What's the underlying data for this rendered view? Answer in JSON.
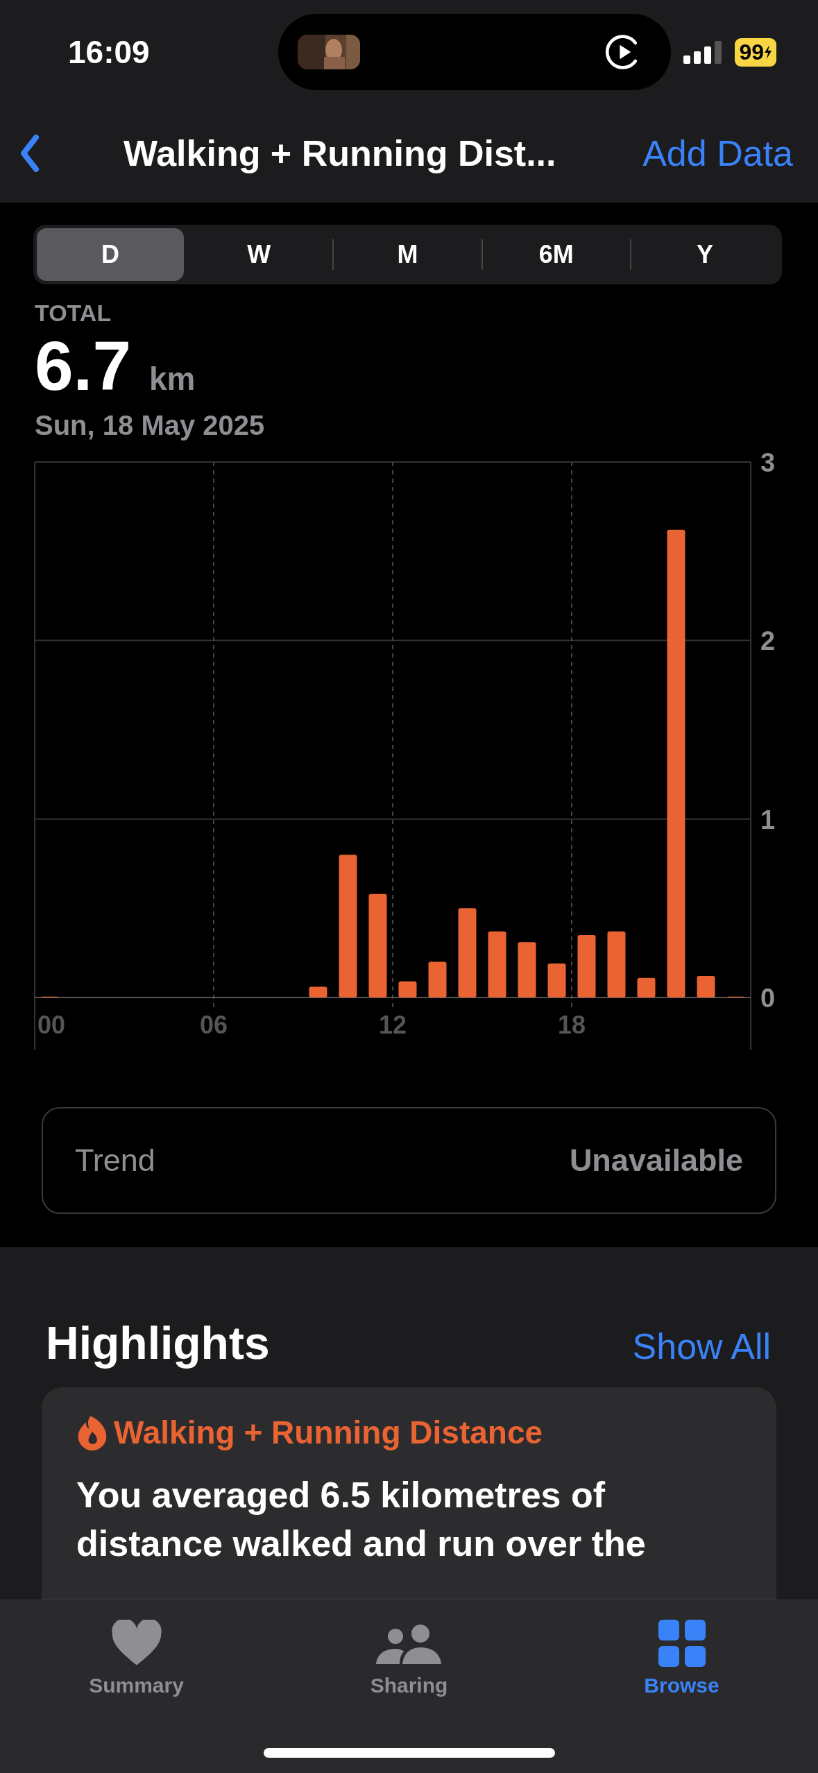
{
  "status_bar": {
    "time": "16:09",
    "battery": "99"
  },
  "nav": {
    "title": "Walking + Running Dist...",
    "action": "Add Data"
  },
  "segments": [
    {
      "label": "D",
      "selected": true
    },
    {
      "label": "W",
      "selected": false
    },
    {
      "label": "M",
      "selected": false
    },
    {
      "label": "6M",
      "selected": false
    },
    {
      "label": "Y",
      "selected": false
    }
  ],
  "summary": {
    "label": "TOTAL",
    "value": "6.7",
    "unit": "km",
    "date": "Sun, 18 May 2025"
  },
  "chart": {
    "chart_data": {
      "type": "bar",
      "x": [
        0.5,
        1.5,
        2.5,
        3.5,
        4.5,
        5.5,
        6.5,
        7.5,
        8.5,
        9.5,
        10.5,
        11.5,
        12.5,
        13.5,
        14.5,
        15.5,
        16.5,
        17.5,
        18.5,
        19.5,
        20.5,
        21.5,
        22.5,
        23.5
      ],
      "xlim": [
        0,
        24
      ],
      "grid": true,
      "values": [
        0.005,
        0,
        0,
        0,
        0,
        0,
        0,
        0,
        0,
        0.06,
        0.8,
        0.58,
        0.09,
        0.2,
        0.5,
        0.37,
        0.31,
        0.19,
        0.35,
        0.37,
        0.11,
        2.62,
        0.12,
        0.005
      ],
      "ylim": [
        0,
        3
      ],
      "yticks": [
        0,
        1,
        2,
        3
      ],
      "xticks": [
        {
          "value": 0,
          "label": "00"
        },
        {
          "value": 6,
          "label": "06"
        },
        {
          "value": 12,
          "label": "12"
        },
        {
          "value": 18,
          "label": "18"
        }
      ]
    }
  },
  "trend": {
    "label": "Trend",
    "value": "Unavailable"
  },
  "highlights": {
    "title": "Highlights",
    "action": "Show All",
    "card_title": "Walking + Running Distance",
    "card_text": "You averaged 6.5 kilometres of distance walked and run over the"
  },
  "tabs": [
    {
      "label": "Summary",
      "kind": "heart",
      "selected": false
    },
    {
      "label": "Sharing",
      "kind": "people",
      "selected": false
    },
    {
      "label": "Browse",
      "kind": "grid",
      "selected": true
    }
  ]
}
